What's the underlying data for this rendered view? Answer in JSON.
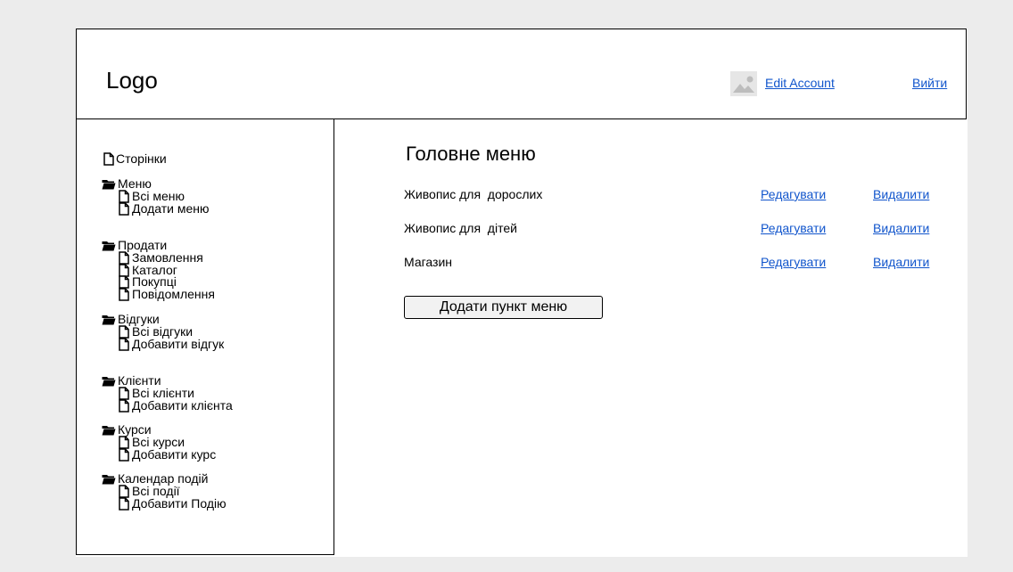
{
  "header": {
    "logo": "Logo",
    "edit_account": "Edit Account",
    "logout": "Вийти",
    "avatar_icon": "image-placeholder-icon"
  },
  "sidebar": {
    "pages": "Сторінки",
    "groups": [
      {
        "label": "Меню",
        "items": [
          "Всі меню",
          "Додати меню"
        ]
      },
      {
        "label": "Продати",
        "items": [
          "Замовлення",
          "Каталог",
          "Покупці",
          "Повідомлення"
        ]
      },
      {
        "label": "Відгуки",
        "items": [
          "Всі відгуки",
          "Добавити відгук"
        ]
      },
      {
        "label": "Клієнти",
        "items": [
          "Всі клієнти",
          "Добавити клієнта"
        ]
      },
      {
        "label": "Курси",
        "items": [
          "Всі курси",
          "Добавити курс"
        ]
      },
      {
        "label": "Календар подій",
        "items": [
          "Всі події",
          "Добавити Подію"
        ]
      }
    ]
  },
  "main": {
    "title": "Головне меню",
    "edit_label": "Редагувати",
    "delete_label": "Видалити",
    "menu_items": [
      "Живопис для  дорослих",
      "Живопис для  дітей",
      "Магазин"
    ],
    "add_button": "Додати пункт меню"
  },
  "colors": {
    "link": "#1155cc",
    "background": "#ececec",
    "button": "#f2f2f2"
  }
}
